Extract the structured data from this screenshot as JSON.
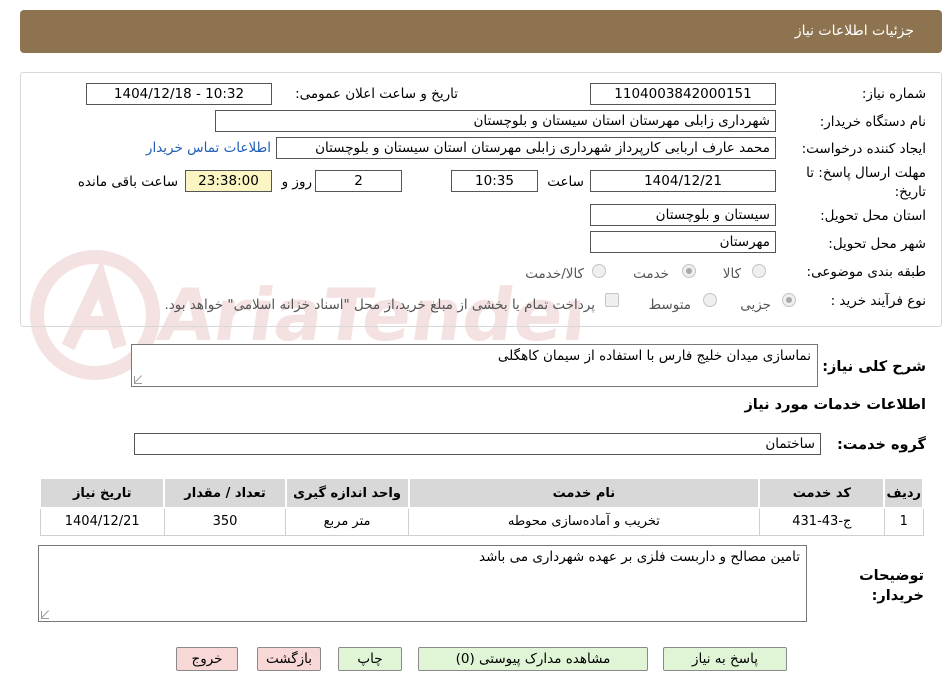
{
  "header": {
    "title": "جزئیات اطلاعات نیاز"
  },
  "form": {
    "need_number_label": "شماره نیاز:",
    "need_number": "1104003842000151",
    "announce_label": "تاریخ و ساعت اعلان عمومی:",
    "announce_value": "1404/12/18 - 10:32",
    "buyer_org_label": "نام دستگاه خریدار:",
    "buyer_org": "شهرداری زابلی مهرستان استان سیستان و بلوچستان",
    "requester_label": "ایجاد کننده درخواست:",
    "requester": "محمد عارف اربابی کارپرداز شهرداری زابلی مهرستان استان سیستان و بلوچستان",
    "contact_link": "اطلاعات تماس خریدار",
    "deadline_label": "مهلت ارسال پاسخ: تا تاریخ:",
    "deadline_date": "1404/12/21",
    "time_label": "ساعت",
    "deadline_time": "10:35",
    "days_value": "2",
    "days_label": "روز و",
    "remaining_time": "23:38:00",
    "remaining_label": "ساعت باقی مانده",
    "province_label": "استان محل تحویل:",
    "province": "سیستان و بلوچستان",
    "city_label": "شهر محل تحویل:",
    "city": "مهرستان",
    "category_label": "طبقه بندی موضوعی:",
    "category_options": [
      "کالا",
      "خدمت",
      "کالا/خدمت"
    ],
    "category_selected": "خدمت",
    "process_label": "نوع فرآیند خرید :",
    "process_options": [
      "جزیی",
      "متوسط"
    ],
    "process_selected": "جزیی",
    "payment_note": "پرداخت تمام یا بخشی از مبلغ خرید،از محل \"اسناد خزانه اسلامی\" خواهد بود.",
    "description_label": "شرح کلی نیاز:",
    "description": "نماسازی میدان خلیج فارس با استفاده از سیمان کاهگلی"
  },
  "services": {
    "section_title": "اطلاعات خدمات مورد نیاز",
    "group_label": "گروه خدمت:",
    "group_value": "ساختمان",
    "columns": [
      "ردیف",
      "کد خدمت",
      "نام خدمت",
      "واحد اندازه گیری",
      "تعداد / مقدار",
      "تاریخ نیاز"
    ],
    "rows": [
      [
        "1",
        "ج-43-431",
        "تخریب و آماده‌سازی محوطه",
        "متر مربع",
        "350",
        "1404/12/21"
      ]
    ]
  },
  "buyer_notes": {
    "label": "توضیحات خریدار:",
    "text": "تامین مصالح و داربست فلزی بر عهده شهرداری می باشد"
  },
  "buttons": {
    "reply": "پاسخ به نیاز",
    "attachments": "مشاهده مدارک پیوستی (0)",
    "print": "چاپ",
    "back": "بازگشت",
    "exit": "خروج"
  },
  "watermark": {
    "text": "AriaTender.neT"
  },
  "colors": {
    "header_bg": "#8e7350",
    "link": "#1f5fb8",
    "button_green": "#dff5d6",
    "button_red": "#f8d7d7",
    "remaining_bg": "#fbf5c4",
    "table_header_bg": "#d8d8d8"
  }
}
